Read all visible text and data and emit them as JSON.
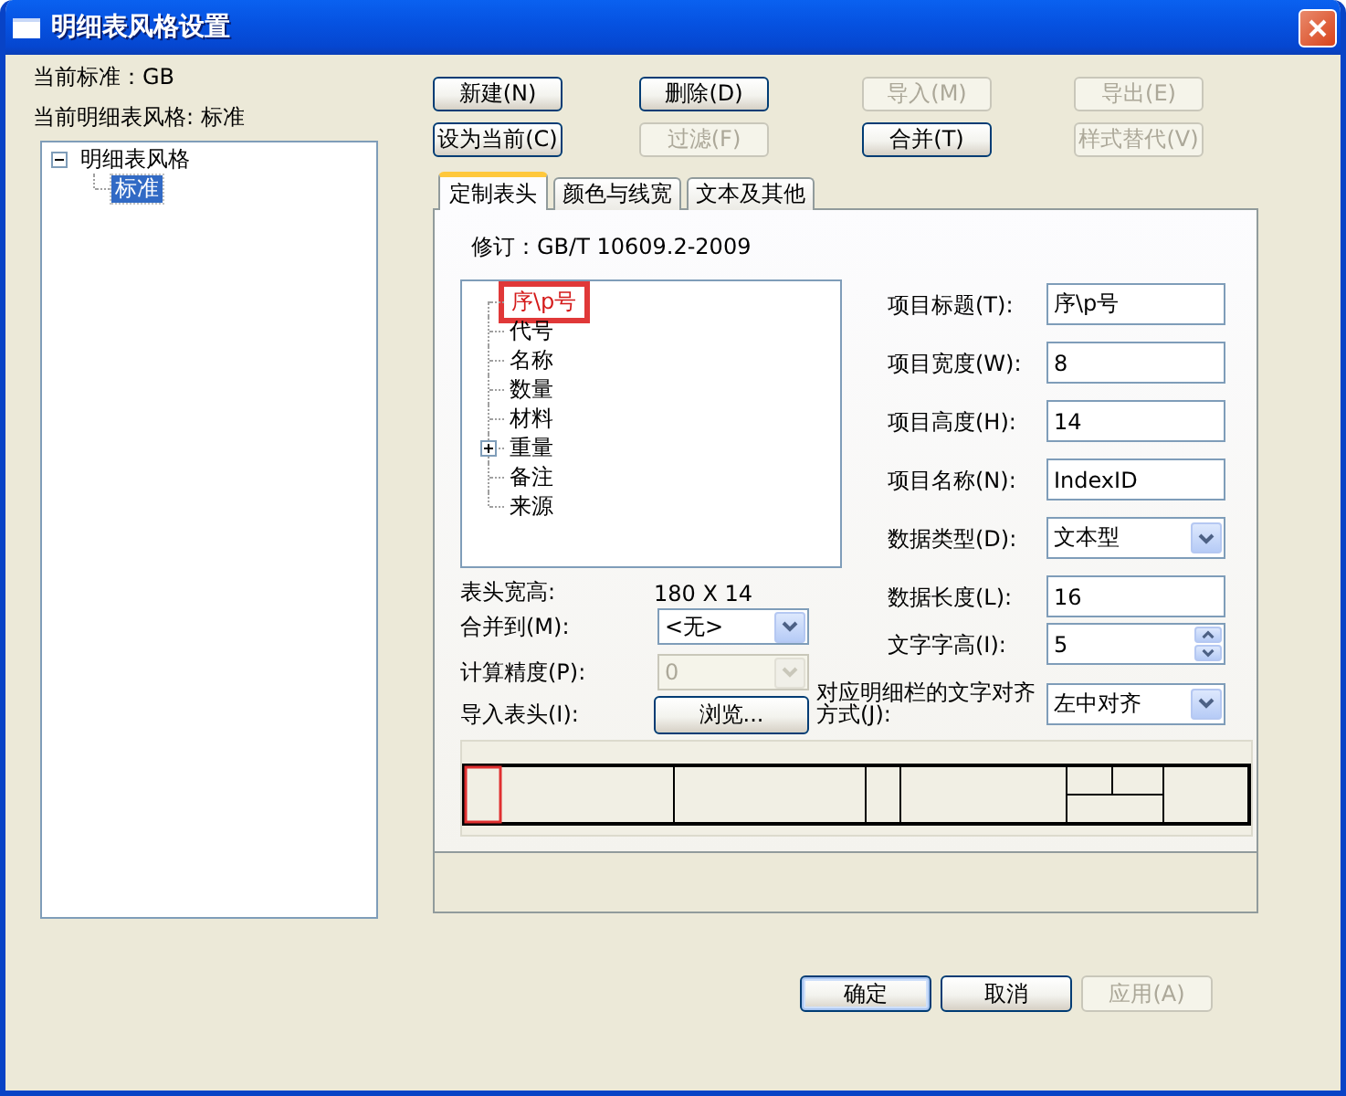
{
  "window": {
    "title": "明细表风格设置"
  },
  "info_lines": [
    "当前标准：GB",
    "当前明细表风格: 标准"
  ],
  "style_tree": [
    {
      "label": "明细表风格",
      "expanded": true,
      "selected": false,
      "children": [
        {
          "label": "标准",
          "selected": true
        }
      ]
    }
  ],
  "toolbar_buttons": [
    {
      "label": "新建(N)",
      "disabled": false
    },
    {
      "label": "删除(D)",
      "disabled": false
    },
    {
      "label": "导入(M)",
      "disabled": true
    },
    {
      "label": "导出(E)",
      "disabled": true
    },
    {
      "label": "设为当前(C)",
      "disabled": false
    },
    {
      "label": "过滤(F)",
      "disabled": true
    },
    {
      "label": "合并(T)",
      "disabled": false
    },
    {
      "label": "样式替代(V)",
      "disabled": true
    }
  ],
  "tabs": [
    {
      "label": "定制表头",
      "selected": true
    },
    {
      "label": "颜色与线宽",
      "selected": false
    },
    {
      "label": "文本及其他",
      "selected": false
    }
  ],
  "revision": "修订：GB/T 10609.2-2009",
  "column_tree": [
    {
      "label": "序\\p号",
      "selected": true
    },
    {
      "label": "代号",
      "selected": false
    },
    {
      "label": "名称",
      "selected": false
    },
    {
      "label": "数量",
      "selected": false
    },
    {
      "label": "材料",
      "selected": false
    },
    {
      "label": "重量",
      "selected": false,
      "expanded": false
    },
    {
      "label": "备注",
      "selected": false
    },
    {
      "label": "来源",
      "selected": false
    }
  ],
  "form_rows": [
    {
      "kind": "readout",
      "label": "表头宽高:",
      "value": "180 X 14"
    },
    {
      "kind": "select",
      "label": "合并到(M):",
      "value": "<无>",
      "disabled": false
    },
    {
      "kind": "select",
      "label": "计算精度(P):",
      "value": "0",
      "disabled": true
    },
    {
      "kind": "button",
      "label": "导入表头(I):",
      "button": "浏览..."
    }
  ],
  "properties": [
    {
      "kind": "text",
      "label": "项目标题(T):",
      "value": "序\\p号"
    },
    {
      "kind": "text",
      "label": "项目宽度(W):",
      "value": "8"
    },
    {
      "kind": "text",
      "label": "项目高度(H):",
      "value": "14"
    },
    {
      "kind": "text",
      "label": "项目名称(N):",
      "value": "IndexID"
    },
    {
      "kind": "select",
      "label": "数据类型(D):",
      "value": "文本型"
    },
    {
      "kind": "text",
      "label": "数据长度(L):",
      "value": "16"
    },
    {
      "kind": "spin",
      "label": "文字字高(I):",
      "value": "5"
    },
    {
      "kind": "select",
      "label": "对应明细栏的文字对齐方式(J):",
      "value": "左中对齐"
    }
  ],
  "dialog_buttons": [
    {
      "label": "确定",
      "default": true,
      "disabled": false
    },
    {
      "label": "取消",
      "default": false,
      "disabled": false
    },
    {
      "label": "应用(A)",
      "default": false,
      "disabled": true
    }
  ]
}
